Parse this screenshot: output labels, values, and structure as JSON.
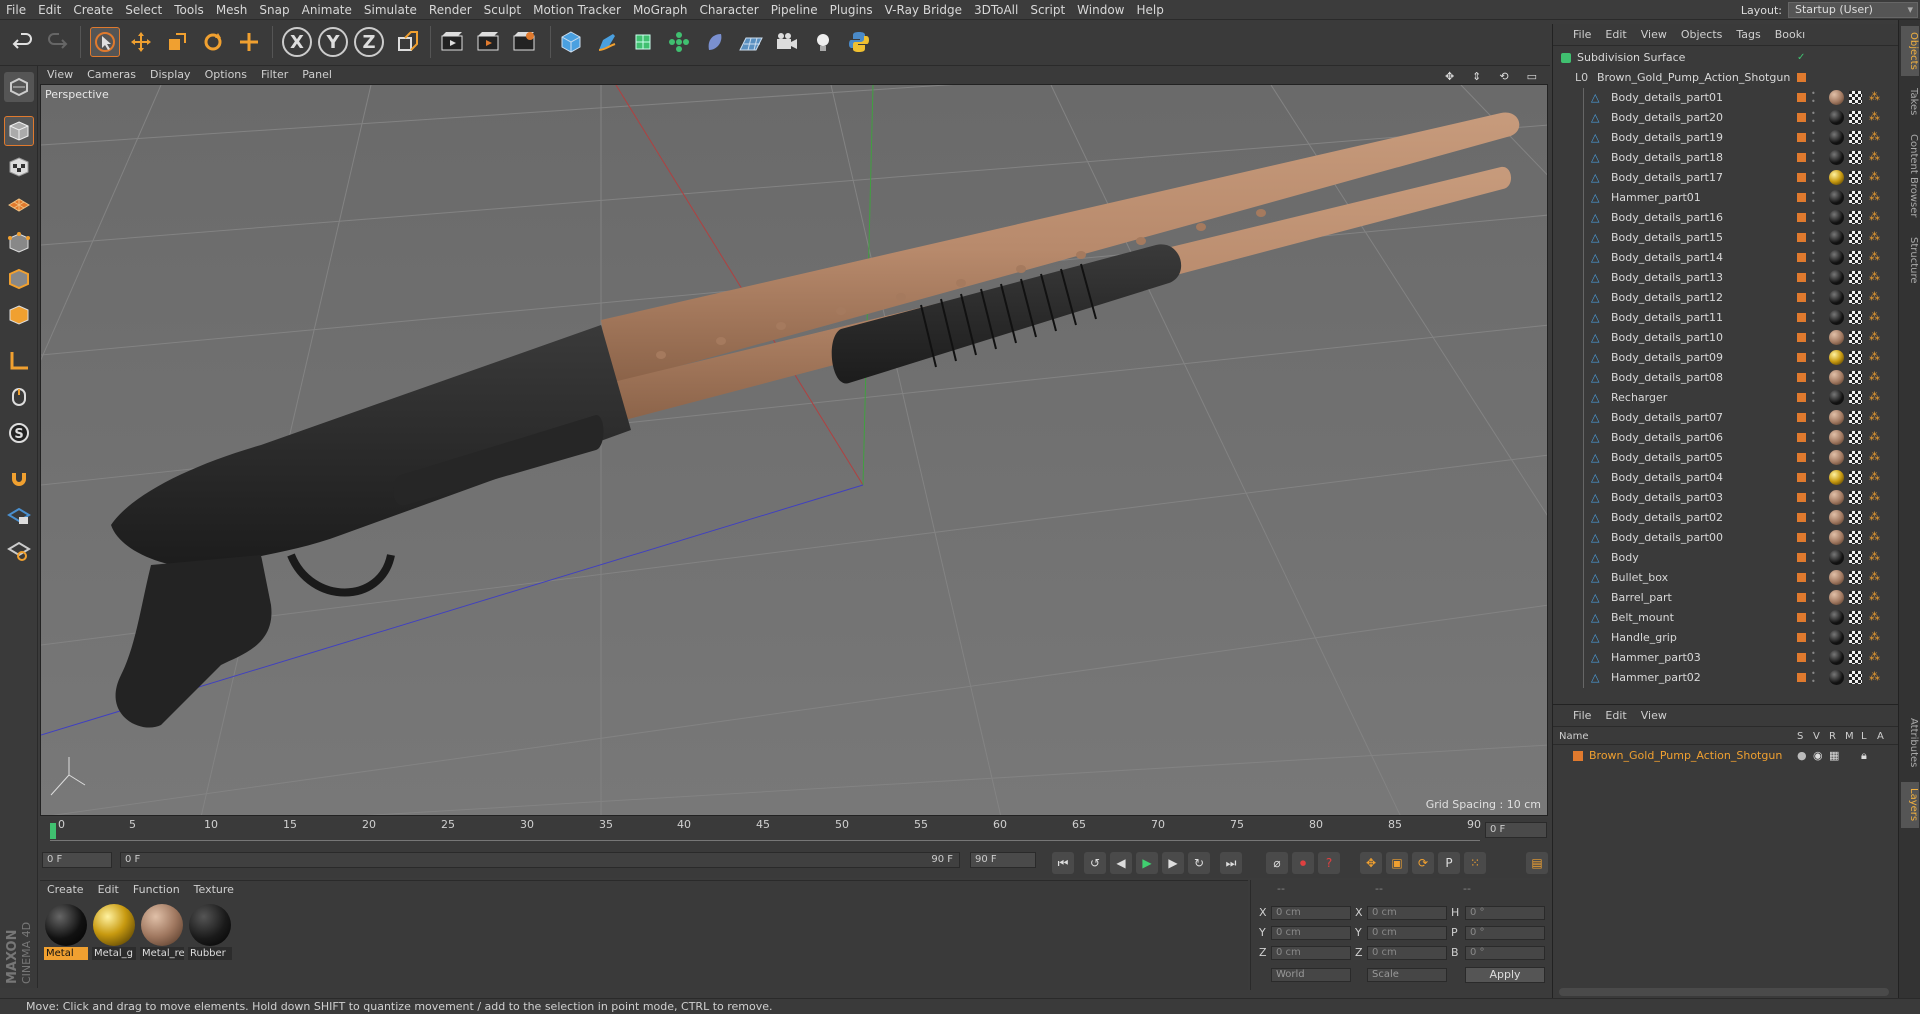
{
  "menubar": {
    "items": [
      "File",
      "Edit",
      "Create",
      "Select",
      "Tools",
      "Mesh",
      "Snap",
      "Animate",
      "Simulate",
      "Render",
      "Sculpt",
      "Motion Tracker",
      "MoGraph",
      "Character",
      "Pipeline",
      "Plugins",
      "V-Ray Bridge",
      "3DToAll",
      "Script",
      "Window",
      "Help"
    ],
    "layout_label": "Layout:",
    "layout_value": "Startup (User)"
  },
  "toolbar": {
    "icons": [
      "undo-icon",
      "redo-icon",
      "live-selection-icon",
      "move-icon",
      "scale-icon",
      "rotate-icon",
      "add-icon",
      "x-axis-icon",
      "y-axis-icon",
      "z-axis-icon",
      "coordinate-system-icon",
      "render-view-icon",
      "render-picture-viewer-icon",
      "edit-render-settings-icon",
      "cube-icon",
      "pen-icon",
      "subdivision-icon",
      "cloner-icon",
      "deformer-icon",
      "floor-icon",
      "camera-icon",
      "light-icon",
      "python-icon"
    ],
    "axis_labels": [
      "X",
      "Y",
      "Z"
    ]
  },
  "viewport": {
    "menu": [
      "View",
      "Cameras",
      "Display",
      "Options",
      "Filter",
      "Panel"
    ],
    "label": "Perspective",
    "grid_spacing": "Grid Spacing : 10 cm"
  },
  "timeline": {
    "ticks": [
      "0",
      "5",
      "10",
      "15",
      "20",
      "25",
      "30",
      "35",
      "40",
      "45",
      "50",
      "55",
      "60",
      "65",
      "70",
      "75",
      "80",
      "85",
      "90"
    ],
    "current_frame": "0 F",
    "start_field": "0 F",
    "slider_start": "0 F",
    "slider_end": "90 F",
    "end_field": "90 F"
  },
  "materials": {
    "menu": [
      "Create",
      "Edit",
      "Function",
      "Texture"
    ],
    "items": [
      {
        "name": "Metal",
        "color": "#111111",
        "selected": true
      },
      {
        "name": "Metal_g",
        "color": "#c89a10",
        "selected": false
      },
      {
        "name": "Metal_re",
        "color": "#a07860",
        "selected": false
      },
      {
        "name": "Rubber",
        "color": "#1a1a1a",
        "selected": false
      }
    ]
  },
  "coordinates": {
    "header": [
      "--",
      "--",
      "--"
    ],
    "rows": [
      {
        "a": "X",
        "av": "0 cm",
        "b": "X",
        "bv": "0 cm",
        "c": "H",
        "cv": "0 °"
      },
      {
        "a": "Y",
        "av": "0 cm",
        "b": "Y",
        "bv": "0 cm",
        "c": "P",
        "cv": "0 °"
      },
      {
        "a": "Z",
        "av": "0 cm",
        "b": "Z",
        "bv": "0 cm",
        "c": "B",
        "cv": "0 °"
      }
    ],
    "mode1": "World",
    "mode2": "Scale",
    "apply": "Apply"
  },
  "objects": {
    "menu": [
      "File",
      "Edit",
      "View",
      "Objects",
      "Tags",
      "Bookı"
    ],
    "root1": "Subdivision Surface",
    "root2": "Brown_Gold_Pump_Action_Shotgun",
    "children": [
      "Body_details_part01",
      "Body_details_part20",
      "Body_details_part19",
      "Body_details_part18",
      "Body_details_part17",
      "Hammer_part01",
      "Body_details_part16",
      "Body_details_part15",
      "Body_details_part14",
      "Body_details_part13",
      "Body_details_part12",
      "Body_details_part11",
      "Body_details_part10",
      "Body_details_part09",
      "Body_details_part08",
      "Recharger",
      "Body_details_part07",
      "Body_details_part06",
      "Body_details_part05",
      "Body_details_part04",
      "Body_details_part03",
      "Body_details_part02",
      "Body_details_part00",
      "Body",
      "Bullet_box",
      "Barrel_part",
      "Belt_mount",
      "Handle_grip",
      "Hammer_part03",
      "Hammer_part02"
    ],
    "materials": [
      "metal_re",
      "metal",
      "metal",
      "metal",
      "metal_g",
      "metal",
      "metal",
      "metal",
      "metal",
      "metal",
      "metal",
      "metal",
      "metal_re",
      "metal_g",
      "metal_re",
      "metal",
      "metal_re",
      "metal_re",
      "metal_re",
      "metal_g",
      "metal_re",
      "metal_re",
      "metal_re",
      "metal",
      "metal_re",
      "metal_re",
      "metal",
      "metal",
      "metal",
      "metal"
    ]
  },
  "layers": {
    "menu": [
      "File",
      "Edit",
      "View"
    ],
    "columns": [
      "Name",
      "S",
      "V",
      "R",
      "M",
      "L",
      "A"
    ],
    "item": "Brown_Gold_Pump_Action_Shotgun"
  },
  "sidetabs": [
    "Objects",
    "Takes",
    "Content Browser",
    "Structure",
    "Attributes",
    "Layers"
  ],
  "status": "Move: Click and drag to move elements. Hold down SHIFT to quantize movement / add to the selection in point mode, CTRL to remove.",
  "brand": "MAXON CINEMA 4D",
  "colors": {
    "accent": "#e07a2e",
    "highlight": "#f0a030",
    "copper": "#b88a6c"
  }
}
